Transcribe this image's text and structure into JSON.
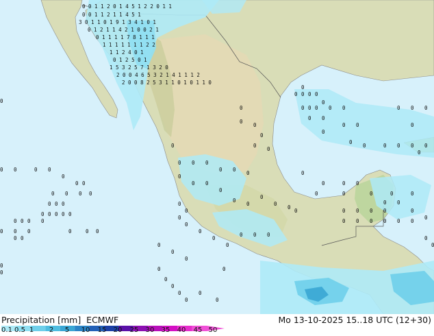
{
  "title": "Precipitation [mm]",
  "source": "ECMWF",
  "datetime": "Mo 13-10-2025 15..18 UTC (12+30)",
  "legend": {
    "values": [
      "0.1",
      "0.5",
      "1",
      "2",
      "5",
      "10",
      "15",
      "20",
      "25",
      "30",
      "35",
      "40",
      "45",
      "50"
    ],
    "colors": [
      "#aeeaf7",
      "#8fdff2",
      "#6ecfea",
      "#4fbde0",
      "#3aa6d4",
      "#2b84c6",
      "#2360b7",
      "#1c40a6",
      "#5a10a8",
      "#8d0fb2",
      "#b80eba",
      "#d40fc4",
      "#e62dcc",
      "#f050d7"
    ]
  },
  "map": {
    "ocean_color": "#d7f1fb",
    "land_color": "#d7dcb3",
    "mountain_color": "#e2d6b2",
    "rain_clusters": [
      {
        "pattern": "0 0 1 1 2 0 1 4 5 1  2 2 0 1 1"
      },
      {
        "pattern": "0 0 1 1 2 1 1 4 5 1"
      },
      {
        "pattern": "3 0 1 1 0 1 9 1 3 4 1 0 1"
      },
      {
        "pattern": "0 1 2 1 1 4 2 1 0 0 2 1"
      },
      {
        "pattern": "0 1 1 1 1 7 8 1 1 1"
      },
      {
        "pattern": "1 1 1 1 1 1 1 2 2"
      },
      {
        "pattern": "1 1 2 4 0 1"
      },
      {
        "pattern": "0 1 2 5 0 1"
      },
      {
        "pattern": "1 5 3 2 5 7 1 3 2 0"
      },
      {
        "pattern": "2 0 0 4 6 5 3 2 1 4 1 1 1 2"
      },
      {
        "pattern": "2 0 0 8 2 5 3 1 1 0 1 0 1 1 0"
      }
    ]
  }
}
